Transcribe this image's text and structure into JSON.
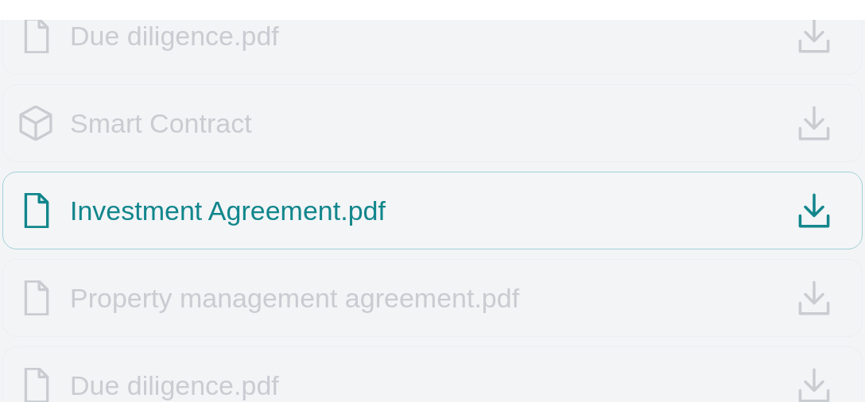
{
  "files": [
    {
      "name": "Due diligence.pdf",
      "kind": "pdf",
      "selected": false
    },
    {
      "name": "Smart Contract",
      "kind": "contract",
      "selected": false
    },
    {
      "name": "Investment Agreement.pdf",
      "kind": "pdf",
      "selected": true
    },
    {
      "name": "Property management agreement.pdf",
      "kind": "pdf",
      "selected": false
    },
    {
      "name": "Due diligence.pdf",
      "kind": "pdf",
      "selected": false
    }
  ]
}
